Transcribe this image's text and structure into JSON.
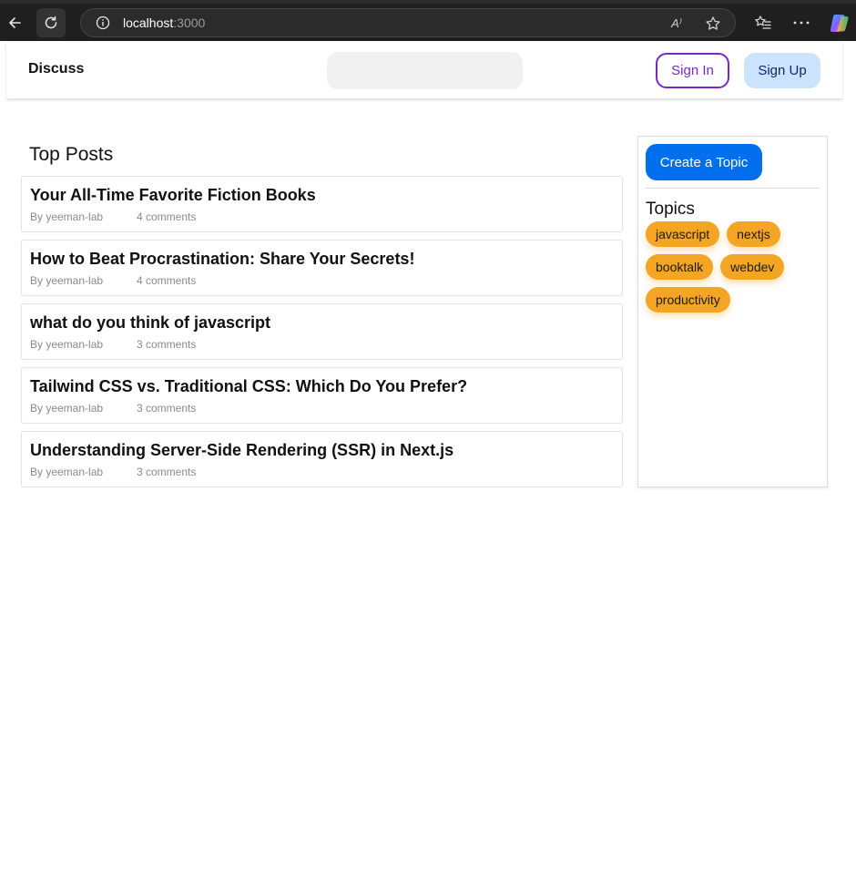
{
  "browser": {
    "url_host": "localhost",
    "url_port": ":3000",
    "read_aloud_glyph": "A⁾"
  },
  "header": {
    "brand": "Discuss",
    "search": {
      "value": "",
      "placeholder": ""
    },
    "sign_in_label": "Sign In",
    "sign_up_label": "Sign Up"
  },
  "main": {
    "section_title": "Top Posts",
    "posts": [
      {
        "title": "Your All-Time Favorite Fiction Books",
        "author": "By yeeman-lab",
        "comments": "4 comments"
      },
      {
        "title": "How to Beat Procrastination: Share Your Secrets!",
        "author": "By yeeman-lab",
        "comments": "4 comments"
      },
      {
        "title": "what do you think of javascript",
        "author": "By yeeman-lab",
        "comments": "3 comments"
      },
      {
        "title": "Tailwind CSS vs. Traditional CSS: Which Do You Prefer?",
        "author": "By yeeman-lab",
        "comments": "3 comments"
      },
      {
        "title": "Understanding Server-Side Rendering (SSR) in Next.js",
        "author": "By yeeman-lab",
        "comments": "3 comments"
      }
    ]
  },
  "sidebar": {
    "create_button_label": "Create a Topic",
    "topics_heading": "Topics",
    "topics": [
      "javascript",
      "nextjs",
      "booktalk",
      "webdev",
      "productivity"
    ]
  },
  "colors": {
    "sign_in_border": "#7828c8",
    "sign_up_bg": "#cce3fd",
    "create_button_bg": "#006fee",
    "chip_bg": "#f5a524"
  }
}
